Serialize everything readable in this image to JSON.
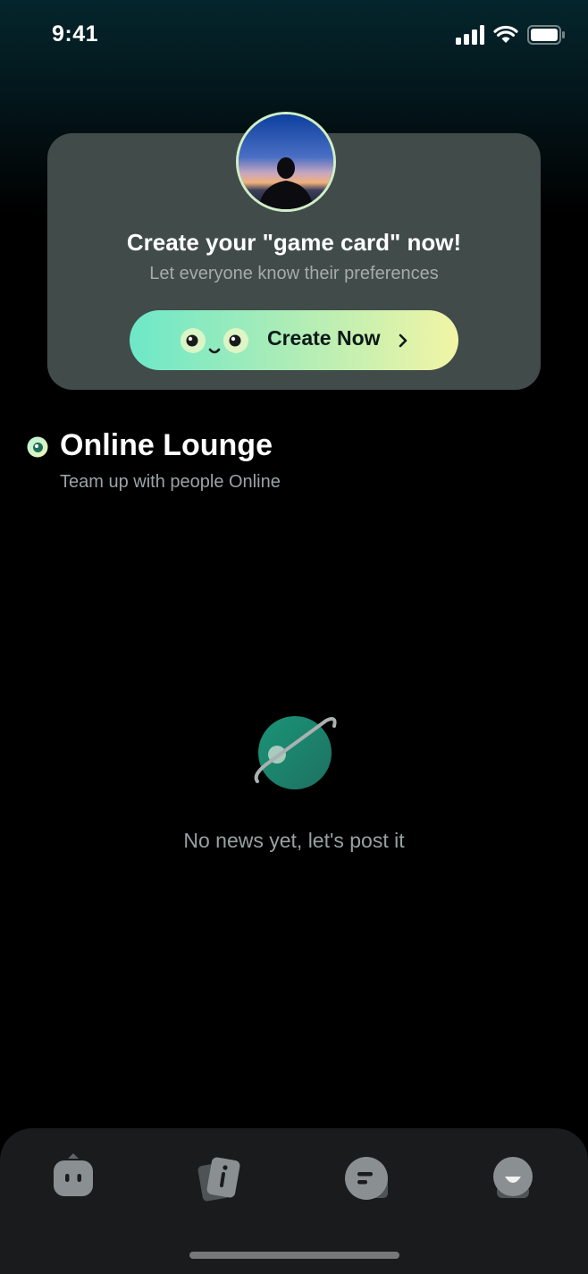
{
  "status_bar": {
    "time": "9:41"
  },
  "card": {
    "title": "Create your \"game card\" now!",
    "subtitle": "Let everyone know their preferences",
    "button_label": "Create Now"
  },
  "section": {
    "title": "Online Lounge",
    "subtitle": "Team up with people Online"
  },
  "empty_state": {
    "message": "No news yet, let's post it"
  },
  "tabbar": {
    "tabs": [
      {
        "icon": "robot-icon"
      },
      {
        "icon": "cards-info-icon"
      },
      {
        "icon": "message-icon"
      },
      {
        "icon": "profile-smile-icon"
      }
    ]
  },
  "colors": {
    "accent_start": "#6de8c8",
    "accent_end": "#f2f5a5",
    "card_bg": "#414b4a",
    "planet": "#1f8f73"
  }
}
